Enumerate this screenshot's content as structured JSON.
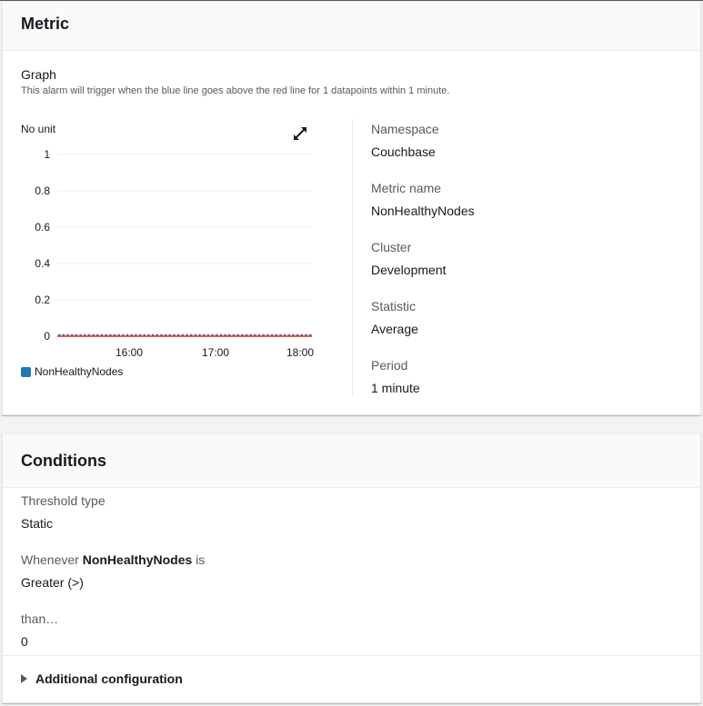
{
  "metric_section": {
    "title": "Metric",
    "graph_label": "Graph",
    "graph_description": "This alarm will trigger when the blue line goes above the red line for 1 datapoints within 1 minute.",
    "chart_unit_label": "No unit",
    "expand_icon": "expand-arrows-icon",
    "details": [
      {
        "label": "Namespace",
        "value": "Couchbase"
      },
      {
        "label": "Metric name",
        "value": "NonHealthyNodes"
      },
      {
        "label": "Cluster",
        "value": "Development"
      },
      {
        "label": "Statistic",
        "value": "Average"
      },
      {
        "label": "Period",
        "value": "1 minute"
      }
    ]
  },
  "chart_data": {
    "type": "line",
    "ylabel": "No unit",
    "ylim": [
      0,
      1
    ],
    "yticks": [
      "1",
      "0.8",
      "0.6",
      "0.4",
      "0.2",
      "0"
    ],
    "xticks": [
      "16:00",
      "17:00",
      "18:00"
    ],
    "grid": true,
    "legend_position": "bottom-left",
    "series": [
      {
        "name": "NonHealthyNodes",
        "color": "#1f77b4",
        "values": [
          0,
          0,
          0,
          0,
          0,
          0,
          0,
          0,
          0,
          0,
          0,
          0,
          0,
          0,
          0,
          0,
          0,
          0,
          0,
          0,
          0,
          0,
          0,
          0,
          0,
          0,
          0,
          0,
          0,
          0,
          0,
          0,
          0,
          0,
          0,
          0,
          0,
          0,
          0,
          0,
          0,
          0,
          0,
          0,
          0,
          0,
          0,
          0,
          0,
          0,
          0,
          0,
          0,
          0,
          0,
          0,
          0,
          0,
          0,
          0
        ],
        "style": "dotted"
      }
    ],
    "threshold": {
      "value": 0,
      "color": "#d13212"
    }
  },
  "conditions_section": {
    "title": "Conditions",
    "threshold_type_label": "Threshold type",
    "threshold_type_value": "Static",
    "whenever_prefix": "Whenever",
    "whenever_metric": "NonHealthyNodes",
    "whenever_suffix": "is",
    "comparison_value": "Greater (>)",
    "than_label": "than…",
    "than_value": "0",
    "additional_config_label": "Additional configuration"
  }
}
